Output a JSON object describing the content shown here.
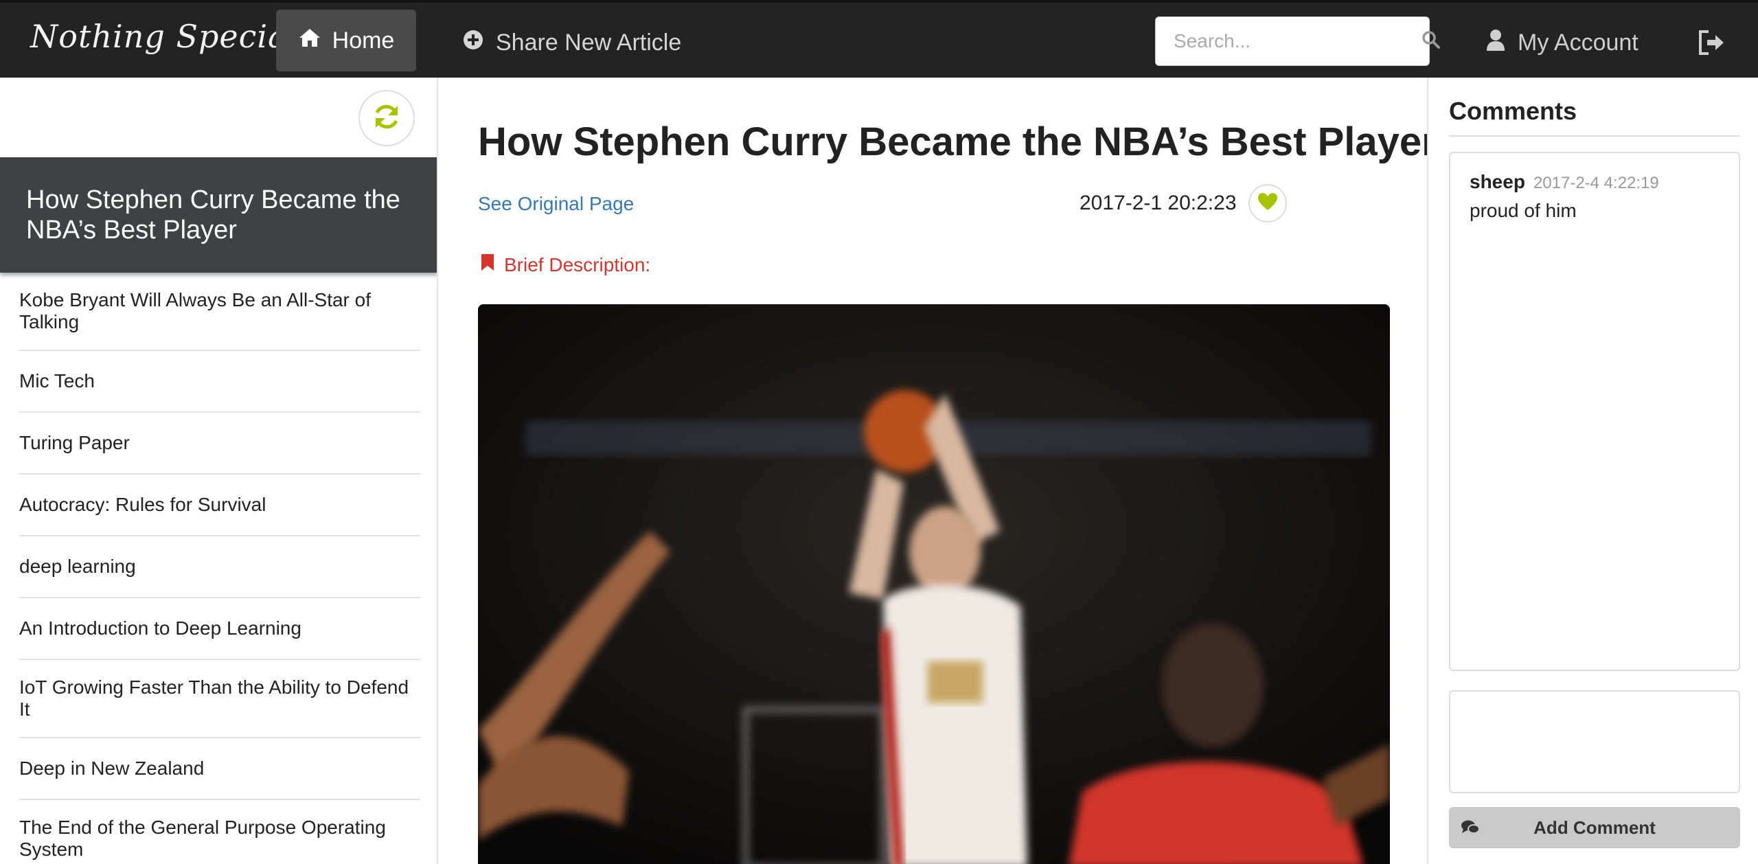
{
  "navbar": {
    "brand": "Nothing Special",
    "home_label": "Home",
    "share_label": "Share New Article",
    "search_placeholder": "Search...",
    "account_label": "My Account",
    "icons": {
      "home": "home-icon",
      "share": "plus-circle-icon",
      "search": "search-icon",
      "account": "user-icon",
      "logout": "sign-out-icon"
    }
  },
  "sidebar": {
    "refresh_icon": "refresh-icon",
    "active_article": "How Stephen Curry Became the NBA’s Best Player",
    "articles": [
      "Kobe Bryant Will Always Be an All-Star of Talking",
      "Mic Tech",
      "Turing Paper",
      "Autocracy: Rules for Survival",
      "deep learning",
      "An Introduction to Deep Learning",
      "IoT Growing Faster Than the Ability to Defend It",
      "Deep in New Zealand",
      "The End of the General Purpose Operating System"
    ]
  },
  "article": {
    "title": "How Stephen Curry Became the NBA’s Best Player",
    "original_link": "See Original Page",
    "date": "2017-2-1 20:2:23",
    "brief_label": "Brief Description:",
    "like_icon": "heart-icon",
    "bookmark_icon": "bookmark-icon"
  },
  "comments": {
    "heading": "Comments",
    "items": [
      {
        "user": "sheep",
        "time": "2017-2-4 4:22:19",
        "text": "proud of him"
      }
    ],
    "input_value": "",
    "add_label": "Add Comment",
    "add_icon": "comments-icon"
  },
  "colors": {
    "navbar_bg": "#232323",
    "accent_green": "#a8c400",
    "link_blue": "#337ab7",
    "brief_red": "#d9342b",
    "active_item_bg": "#3e4245"
  }
}
